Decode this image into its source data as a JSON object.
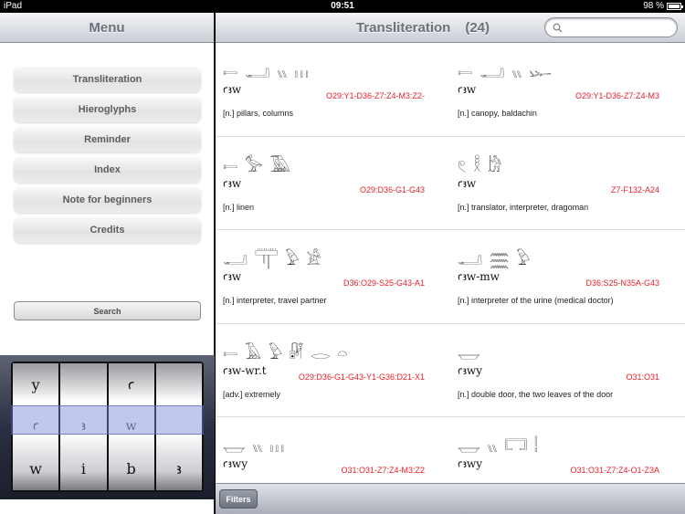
{
  "status_bar": {
    "device": "iPad",
    "time": "09:51",
    "battery": "98 %"
  },
  "sidebar": {
    "title": "Menu",
    "items": [
      {
        "label": "Transliteration"
      },
      {
        "label": "Hieroglyphs"
      },
      {
        "label": "Reminder"
      },
      {
        "label": "Index"
      },
      {
        "label": "Note for beginners"
      },
      {
        "label": "Credits"
      }
    ],
    "search_label": "Search",
    "picker": {
      "wheels": [
        [
          "y",
          "ꜥ",
          "w"
        ],
        [
          "",
          "ꜣ",
          "i"
        ],
        [
          "ꜥ",
          "w",
          "b"
        ],
        [
          "",
          "",
          "ꜣ"
        ]
      ],
      "selected": [
        "ꜥ",
        "ꜣ",
        "w",
        ""
      ]
    }
  },
  "main": {
    "title": "Transliteration",
    "count": "(24)",
    "search": {
      "placeholder": "",
      "value": ""
    },
    "entries": [
      {
        "glyphs": "𓍿 𓂝 𓏭 𓏥",
        "translit": "ꜥꜣw",
        "code": "O29:Y1-D36-Z7:Z4-M3:Z2-",
        "meaning": "[n.] pillars, columns"
      },
      {
        "glyphs": "𓍿 𓂝 𓏭 𓆱",
        "translit": "ꜥꜣw",
        "code": "O29:Y1-D36-Z7:Z4-M3",
        "meaning": "[n.] canopy, baldachin"
      },
      {
        "glyphs": "𓍿 𓅞 𓅀",
        "translit": "ꜥꜣw",
        "code": "O29:D36-G1-G43",
        "meaning": "[n.] linen"
      },
      {
        "glyphs": "𓏲 𓎛 𓀘",
        "translit": "ꜥꜣw",
        "code": "Z7-F132-A24",
        "meaning": "[n.] translator, interpreter, dragoman"
      },
      {
        "glyphs": "𓂝 𓋳 𓅱 𓀀",
        "translit": "ꜥꜣw",
        "code": "D36:O29-S25-G43-A1",
        "meaning": "[n.] interpreter, travel partner"
      },
      {
        "glyphs": "𓂝 𓈗 𓅱",
        "translit": "ꜥꜣw-mw",
        "code": "D36:S25-N35A-G43",
        "meaning": "[n.] interpreter of the urine (medical doctor)"
      },
      {
        "glyphs": "𓍿 𓄿 𓅱 𓏞 𓂋 𓏏",
        "translit": "ꜥꜣw-wr.t",
        "code": "O29:D36-G1-G43-Y1-G36:D21-X1",
        "meaning": "[adv.] extremely"
      },
      {
        "glyphs": "𓉿",
        "translit": "ꜥꜣwy",
        "code": "O31:O31",
        "meaning": "[n.] double door, the two leaves of the door"
      },
      {
        "glyphs": "𓉿 𓏭 𓏥",
        "translit": "ꜥꜣwy",
        "code": "O31:O31-Z7:Z4-M3:Z2",
        "meaning": ""
      },
      {
        "glyphs": "𓉿 𓏭 𓉐 𓏪",
        "translit": "ꜥꜣwy",
        "code": "O31:O31-Z7:Z4-O1-Z3A",
        "meaning": ""
      }
    ],
    "filters_label": "Filters"
  },
  "colors": {
    "code_red": "#e8202a",
    "nav_text": "#6b7079"
  }
}
